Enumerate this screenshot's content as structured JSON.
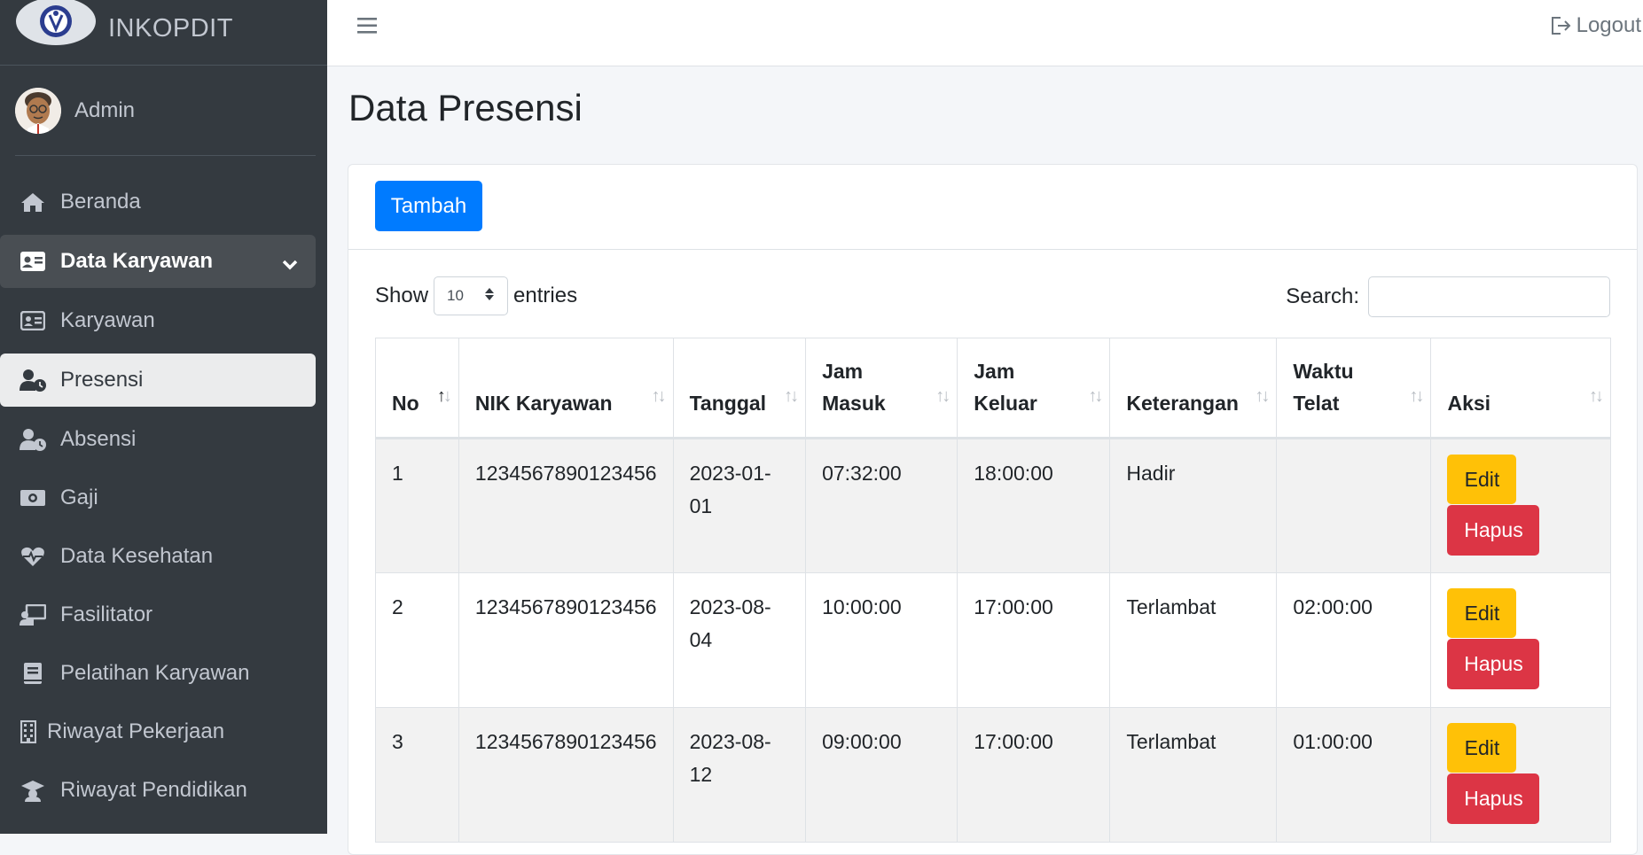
{
  "brand": {
    "name": "INKOPDIT"
  },
  "user": {
    "name": "Admin"
  },
  "sidebar": {
    "items": [
      {
        "label": "Beranda",
        "icon": "home-icon"
      },
      {
        "label": "Data Karyawan",
        "icon": "id-card-icon"
      },
      {
        "label": "Karyawan",
        "icon": "id-card-icon"
      },
      {
        "label": "Presensi",
        "icon": "user-clock-icon"
      },
      {
        "label": "Absensi",
        "icon": "user-clock-icon"
      },
      {
        "label": "Gaji",
        "icon": "money-icon"
      },
      {
        "label": "Data Kesehatan",
        "icon": "heartbeat-icon"
      },
      {
        "label": "Fasilitator",
        "icon": "chalkboard-teacher-icon"
      },
      {
        "label": "Pelatihan Karyawan",
        "icon": "book-icon"
      },
      {
        "label": "Riwayat Pekerjaan",
        "icon": "building-icon"
      },
      {
        "label": "Riwayat Pendidikan",
        "icon": "graduation-cap-icon"
      }
    ]
  },
  "topbar": {
    "logout_label": "Logout"
  },
  "page": {
    "title": "Data Presensi"
  },
  "toolbar": {
    "add_label": "Tambah"
  },
  "table_controls": {
    "show_label": "Show",
    "entries_value": "10",
    "entries_label": "entries",
    "search_label": "Search:"
  },
  "table": {
    "headers": [
      "No",
      "NIK Karyawan",
      "Tanggal",
      "Jam Masuk",
      "Jam Keluar",
      "Keterangan",
      "Waktu Telat",
      "Aksi"
    ],
    "rows": [
      {
        "no": "1",
        "nik": "1234567890123456",
        "tanggal": "2023-01-01",
        "jam_masuk": "07:32:00",
        "jam_keluar": "18:00:00",
        "keterangan": "Hadir",
        "waktu_telat": ""
      },
      {
        "no": "2",
        "nik": "1234567890123456",
        "tanggal": "2023-08-04",
        "jam_masuk": "10:00:00",
        "jam_keluar": "17:00:00",
        "keterangan": "Terlambat",
        "waktu_telat": "02:00:00"
      },
      {
        "no": "3",
        "nik": "1234567890123456",
        "tanggal": "2023-08-12",
        "jam_masuk": "09:00:00",
        "jam_keluar": "17:00:00",
        "keterangan": "Terlambat",
        "waktu_telat": "01:00:00"
      }
    ],
    "edit_label": "Edit",
    "delete_label": "Hapus"
  },
  "colors": {
    "sidebar_bg": "#343a40",
    "primary": "#007bff",
    "warning": "#ffc107",
    "danger": "#dc3545"
  }
}
